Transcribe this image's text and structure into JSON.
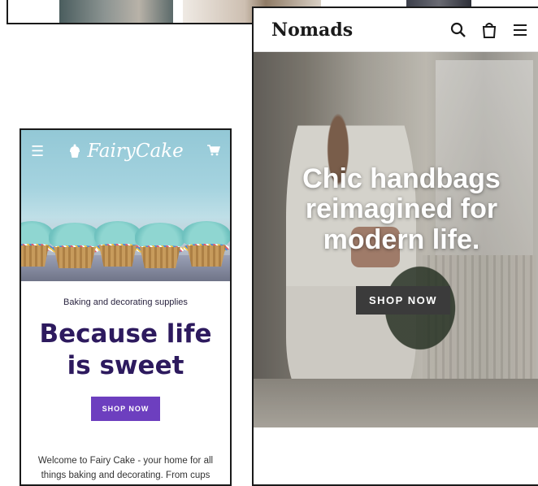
{
  "fairycake": {
    "logo": "FairyCake",
    "tagline": "Baking and decorating supplies",
    "heading": "Because life is sweet",
    "shop_button": "SHOP NOW",
    "welcome_text": "Welcome to Fairy Cake - your home for all things baking and decorating. From cups and"
  },
  "nomads": {
    "logo": "Nomads",
    "headline": "Chic handbags reimagined for modern life.",
    "shop_button": "SHOP NOW"
  },
  "colors": {
    "fairycake_heading": "#2d1a5e",
    "fairycake_button": "#6d3fbf",
    "nomads_button": "#3b3b3b"
  },
  "icons": [
    "hamburger-menu-icon",
    "cupcake-icon",
    "cart-icon",
    "search-icon",
    "shopping-bag-icon"
  ]
}
